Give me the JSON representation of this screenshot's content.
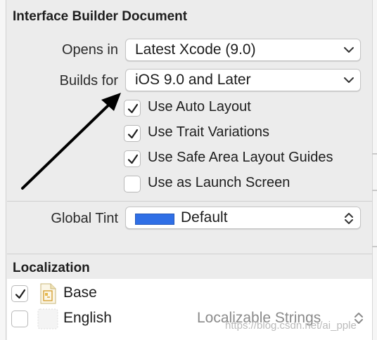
{
  "document_section": {
    "title": "Interface Builder Document",
    "opens_in": {
      "label": "Opens in",
      "value": "Latest Xcode (9.0)"
    },
    "builds_for": {
      "label": "Builds for",
      "value": "iOS 9.0 and Later"
    },
    "options": [
      {
        "label": "Use Auto Layout",
        "checked": true
      },
      {
        "label": "Use Trait Variations",
        "checked": true
      },
      {
        "label": "Use Safe Area Layout Guides",
        "checked": true
      },
      {
        "label": "Use as Launch Screen",
        "checked": false
      }
    ],
    "global_tint": {
      "label": "Global Tint",
      "value": "Default",
      "swatch_color": "#2f6fe6"
    }
  },
  "localization_section": {
    "title": "Localization",
    "items": [
      {
        "name": "Base",
        "checked": true,
        "type": ""
      },
      {
        "name": "English",
        "checked": false,
        "type": "Localizable Strings"
      }
    ]
  },
  "watermark": "https://blog.csdn.net/ai_pple",
  "colors": {
    "accent": "#2f6fe6",
    "arrow": "#000000"
  }
}
